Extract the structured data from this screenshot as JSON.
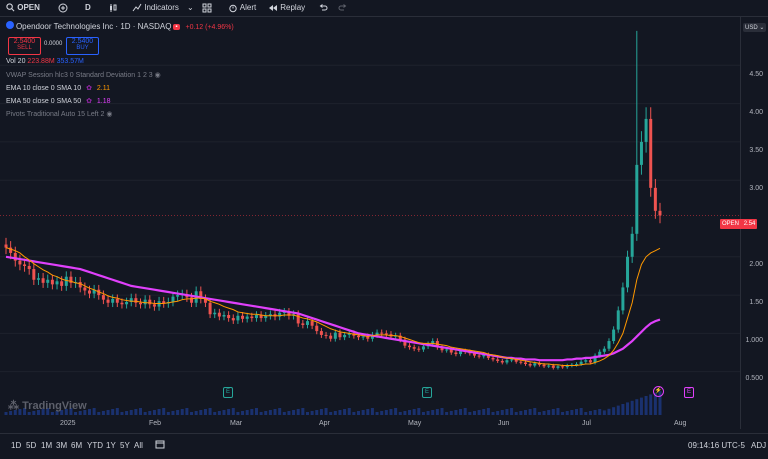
{
  "toolbar": {
    "symbol": "OPEN",
    "interval": "D",
    "indicators": "Indicators",
    "alert": "Alert",
    "replay": "Replay"
  },
  "header": {
    "title": "Opendoor Technologies Inc · 1D · NASDAQ",
    "change": "+0.12 (+4.96%)",
    "sell_price": "2.5400",
    "sell_label": "SELL",
    "spread": "0.0000",
    "buy_price": "2.5400",
    "buy_label": "BUY"
  },
  "legend": {
    "vol_label": "Vol 20",
    "vol_v1": "223.88M",
    "vol_v2": "353.57M",
    "vwap": "VWAP Session hlc3 0 Standard Deviation 1 2 3",
    "ema10": "EMA 10 close 0 SMA 10",
    "ema10_val": "2.11",
    "ema50": "EMA 50 close 0 SMA 50",
    "ema50_val": "1.18",
    "pivots": "Pivots Traditional Auto 15 Left 2"
  },
  "scale": {
    "currency": "USD",
    "ticks": [
      "4.50",
      "4.00",
      "3.50",
      "3.00",
      "2.00",
      "1.50",
      "1.000",
      "0.500"
    ],
    "price_tag_label": "OPEN",
    "price_tag_value": "2.54"
  },
  "x_axis": [
    "2025",
    "Feb",
    "Mar",
    "Apr",
    "May",
    "Jun",
    "Jul",
    "Aug"
  ],
  "events": [
    "E",
    "E",
    "E"
  ],
  "watermark": "TradingView",
  "ranges": [
    "1D",
    "5D",
    "1M",
    "3M",
    "6M",
    "YTD",
    "1Y",
    "5Y",
    "All"
  ],
  "status": {
    "time": "09:14:16 UTC-5",
    "adj": "ADJ"
  },
  "colors": {
    "up": "#26a69a",
    "down": "#ef5350",
    "ema50": "#e040fb",
    "ema10": "#ff9800",
    "background": "#131722"
  },
  "chart_data": {
    "type": "candlestick",
    "x": [
      "2024-12-26",
      "2024-12-27",
      "2024-12-30",
      "2024-12-31",
      "2025-01-02",
      "2025-01-03",
      "2025-01-06",
      "2025-01-07",
      "2025-01-08",
      "2025-01-09",
      "2025-01-10",
      "2025-01-13",
      "2025-01-14",
      "2025-01-15",
      "2025-01-16",
      "2025-01-17",
      "2025-01-21",
      "2025-01-22",
      "2025-01-23",
      "2025-01-24",
      "2025-01-27",
      "2025-01-28",
      "2025-01-29",
      "2025-01-30",
      "2025-01-31",
      "2025-02-03",
      "2025-02-04",
      "2025-02-05",
      "2025-02-06",
      "2025-02-07",
      "2025-02-10",
      "2025-02-11",
      "2025-02-12",
      "2025-02-13",
      "2025-02-14",
      "2025-02-18",
      "2025-02-19",
      "2025-02-20",
      "2025-02-21",
      "2025-02-24",
      "2025-02-25",
      "2025-02-26",
      "2025-02-27",
      "2025-02-28",
      "2025-03-03",
      "2025-03-04",
      "2025-03-05",
      "2025-03-06",
      "2025-03-07",
      "2025-03-10",
      "2025-03-11",
      "2025-03-12",
      "2025-03-13",
      "2025-03-14",
      "2025-03-17",
      "2025-03-18",
      "2025-03-19",
      "2025-03-20",
      "2025-03-21",
      "2025-03-24",
      "2025-03-25",
      "2025-03-26",
      "2025-03-27",
      "2025-03-28",
      "2025-03-31",
      "2025-04-01",
      "2025-04-02",
      "2025-04-03",
      "2025-04-04",
      "2025-04-07",
      "2025-04-08",
      "2025-04-09",
      "2025-04-10",
      "2025-04-11",
      "2025-04-14",
      "2025-04-15",
      "2025-04-16",
      "2025-04-17",
      "2025-04-21",
      "2025-04-22",
      "2025-04-23",
      "2025-04-24",
      "2025-04-25",
      "2025-04-28",
      "2025-04-29",
      "2025-04-30",
      "2025-05-01",
      "2025-05-02",
      "2025-05-05",
      "2025-05-06",
      "2025-05-07",
      "2025-05-08",
      "2025-05-09",
      "2025-05-12",
      "2025-05-13",
      "2025-05-14",
      "2025-05-15",
      "2025-05-16",
      "2025-05-19",
      "2025-05-20",
      "2025-05-21",
      "2025-05-22",
      "2025-05-23",
      "2025-05-27",
      "2025-05-28",
      "2025-05-29",
      "2025-05-30",
      "2025-06-02",
      "2025-06-03",
      "2025-06-04",
      "2025-06-05",
      "2025-06-06",
      "2025-06-09",
      "2025-06-10",
      "2025-06-11",
      "2025-06-12",
      "2025-06-13",
      "2025-06-16",
      "2025-06-17",
      "2025-06-18",
      "2025-06-20",
      "2025-06-23",
      "2025-06-24",
      "2025-06-25",
      "2025-06-26",
      "2025-06-27",
      "2025-06-30",
      "2025-07-01",
      "2025-07-02",
      "2025-07-03",
      "2025-07-07",
      "2025-07-08",
      "2025-07-09",
      "2025-07-10",
      "2025-07-11",
      "2025-07-14",
      "2025-07-15",
      "2025-07-16",
      "2025-07-17",
      "2025-07-18",
      "2025-07-21",
      "2025-07-22",
      "2025-07-23",
      "2025-07-24",
      "2025-07-25"
    ],
    "close": [
      2.12,
      2.05,
      1.95,
      1.9,
      1.88,
      1.84,
      1.7,
      1.72,
      1.66,
      1.7,
      1.64,
      1.68,
      1.62,
      1.74,
      1.66,
      1.67,
      1.6,
      1.56,
      1.52,
      1.57,
      1.5,
      1.44,
      1.4,
      1.45,
      1.4,
      1.38,
      1.41,
      1.46,
      1.4,
      1.38,
      1.44,
      1.38,
      1.35,
      1.42,
      1.39,
      1.41,
      1.48,
      1.5,
      1.51,
      1.47,
      1.4,
      1.55,
      1.45,
      1.4,
      1.25,
      1.27,
      1.22,
      1.24,
      1.2,
      1.17,
      1.23,
      1.19,
      1.22,
      1.2,
      1.24,
      1.2,
      1.23,
      1.25,
      1.22,
      1.27,
      1.28,
      1.23,
      1.25,
      1.13,
      1.11,
      1.16,
      1.1,
      1.03,
      0.98,
      0.97,
      0.93,
      1.01,
      0.95,
      0.98,
      1.0,
      0.97,
      0.95,
      0.96,
      0.93,
      0.98,
      1.01,
      1.0,
      0.99,
      0.96,
      0.97,
      0.92,
      0.84,
      0.82,
      0.8,
      0.79,
      0.83,
      0.86,
      0.9,
      0.82,
      0.78,
      0.79,
      0.75,
      0.73,
      0.77,
      0.76,
      0.74,
      0.71,
      0.7,
      0.72,
      0.68,
      0.66,
      0.64,
      0.62,
      0.65,
      0.66,
      0.63,
      0.62,
      0.6,
      0.58,
      0.61,
      0.59,
      0.57,
      0.58,
      0.55,
      0.57,
      0.56,
      0.58,
      0.59,
      0.6,
      0.63,
      0.65,
      0.62,
      0.71,
      0.76,
      0.8,
      0.9,
      1.05,
      1.3,
      1.6,
      2.0,
      2.3,
      3.2,
      3.5,
      3.8,
      2.9,
      2.6,
      2.54
    ],
    "ema10": [
      2.12,
      2.1,
      2.08,
      2.05,
      2.0,
      1.96,
      1.91,
      1.87,
      1.83,
      1.8,
      1.76,
      1.74,
      1.71,
      1.69,
      1.68,
      1.66,
      1.65,
      1.62,
      1.59,
      1.57,
      1.54,
      1.52,
      1.49,
      1.47,
      1.46,
      1.44,
      1.43,
      1.42,
      1.42,
      1.41,
      1.4,
      1.4,
      1.39,
      1.39,
      1.39,
      1.4,
      1.41,
      1.42,
      1.44,
      1.45,
      1.45,
      1.46,
      1.46,
      1.45,
      1.42,
      1.4,
      1.38,
      1.35,
      1.33,
      1.31,
      1.28,
      1.27,
      1.26,
      1.25,
      1.25,
      1.24,
      1.23,
      1.23,
      1.23,
      1.23,
      1.24,
      1.24,
      1.24,
      1.22,
      1.2,
      1.19,
      1.17,
      1.15,
      1.12,
      1.09,
      1.06,
      1.04,
      1.02,
      1.01,
      1.0,
      0.99,
      0.98,
      0.97,
      0.96,
      0.97,
      0.98,
      0.98,
      0.98,
      0.97,
      0.97,
      0.96,
      0.94,
      0.92,
      0.9,
      0.88,
      0.87,
      0.87,
      0.87,
      0.86,
      0.85,
      0.84,
      0.82,
      0.81,
      0.8,
      0.79,
      0.78,
      0.77,
      0.76,
      0.75,
      0.73,
      0.72,
      0.71,
      0.69,
      0.68,
      0.67,
      0.66,
      0.65,
      0.64,
      0.63,
      0.62,
      0.61,
      0.6,
      0.6,
      0.59,
      0.59,
      0.58,
      0.58,
      0.58,
      0.58,
      0.59,
      0.6,
      0.6,
      0.62,
      0.64,
      0.67,
      0.71,
      0.78,
      0.88,
      1.0,
      1.2,
      1.4,
      1.7,
      1.9,
      2.0,
      2.05,
      2.08,
      2.11
    ],
    "ema50": [
      2.0,
      1.99,
      1.98,
      1.97,
      1.96,
      1.95,
      1.94,
      1.93,
      1.92,
      1.91,
      1.9,
      1.89,
      1.88,
      1.87,
      1.86,
      1.85,
      1.84,
      1.82,
      1.8,
      1.78,
      1.76,
      1.74,
      1.72,
      1.7,
      1.68,
      1.66,
      1.64,
      1.62,
      1.61,
      1.6,
      1.59,
      1.58,
      1.57,
      1.56,
      1.55,
      1.54,
      1.53,
      1.52,
      1.51,
      1.5,
      1.49,
      1.48,
      1.47,
      1.46,
      1.45,
      1.44,
      1.43,
      1.42,
      1.41,
      1.4,
      1.39,
      1.38,
      1.37,
      1.36,
      1.35,
      1.34,
      1.33,
      1.32,
      1.31,
      1.3,
      1.29,
      1.28,
      1.27,
      1.26,
      1.24,
      1.22,
      1.2,
      1.18,
      1.16,
      1.14,
      1.12,
      1.1,
      1.08,
      1.06,
      1.04,
      1.02,
      1.0,
      0.99,
      0.98,
      0.97,
      0.96,
      0.95,
      0.94,
      0.93,
      0.92,
      0.91,
      0.9,
      0.89,
      0.88,
      0.87,
      0.86,
      0.85,
      0.84,
      0.83,
      0.82,
      0.81,
      0.8,
      0.79,
      0.78,
      0.77,
      0.76,
      0.75,
      0.74,
      0.73,
      0.72,
      0.71,
      0.7,
      0.69,
      0.68,
      0.68,
      0.67,
      0.67,
      0.66,
      0.66,
      0.66,
      0.65,
      0.65,
      0.65,
      0.65,
      0.65,
      0.65,
      0.66,
      0.66,
      0.67,
      0.67,
      0.68,
      0.68,
      0.69,
      0.7,
      0.71,
      0.72,
      0.74,
      0.77,
      0.8,
      0.85,
      0.9,
      0.96,
      1.02,
      1.08,
      1.13,
      1.16,
      1.18
    ],
    "spike_high": 4.95,
    "ylim": [
      0.3,
      5.0
    ],
    "last_price": 2.54
  }
}
